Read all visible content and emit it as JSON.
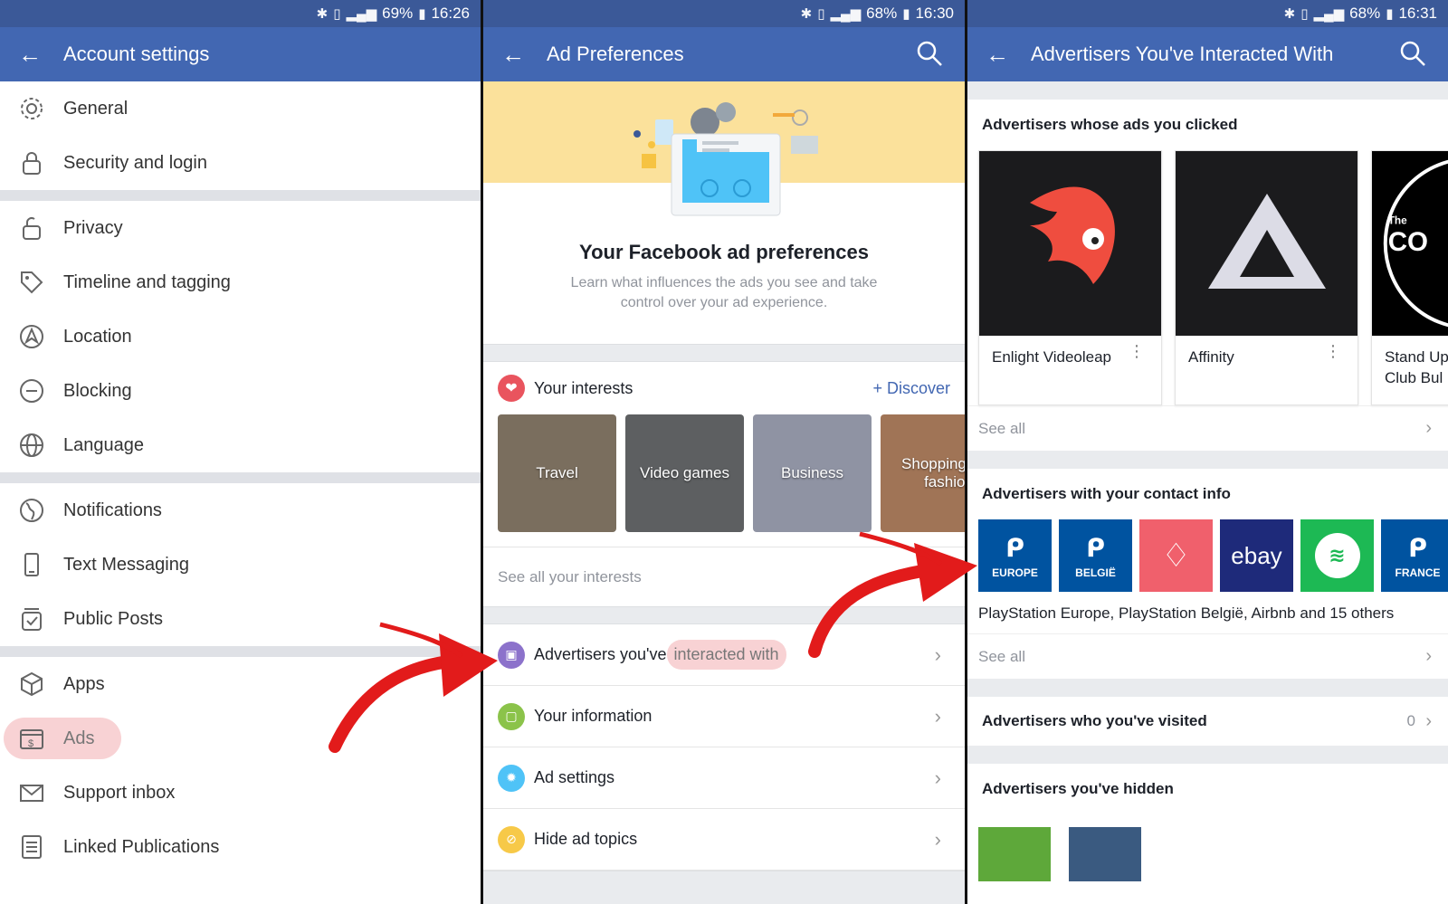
{
  "panel1": {
    "status": {
      "battery": "69%",
      "time": "16:26"
    },
    "appbar": {
      "title": "Account settings"
    },
    "items": [
      {
        "label": "General",
        "icon": "gear-icon"
      },
      {
        "label": "Security and login",
        "icon": "lock-icon"
      },
      {
        "label": "Privacy",
        "icon": "lock-privacy-icon"
      },
      {
        "label": "Timeline and tagging",
        "icon": "tag-icon"
      },
      {
        "label": "Location",
        "icon": "location-icon"
      },
      {
        "label": "Blocking",
        "icon": "blocking-icon"
      },
      {
        "label": "Language",
        "icon": "globe-icon"
      },
      {
        "label": "Notifications",
        "icon": "globe-notifications-icon"
      },
      {
        "label": "Text Messaging",
        "icon": "phone-icon"
      },
      {
        "label": "Public Posts",
        "icon": "public-posts-icon"
      },
      {
        "label": "Apps",
        "icon": "cube-icon"
      },
      {
        "label": "Ads",
        "icon": "ads-icon"
      },
      {
        "label": "Support inbox",
        "icon": "envelope-icon"
      },
      {
        "label": "Linked Publications",
        "icon": "document-icon"
      }
    ]
  },
  "panel2": {
    "status": {
      "battery": "68%",
      "time": "16:30"
    },
    "appbar": {
      "title": "Ad Preferences"
    },
    "hero": {
      "title": "Your Facebook ad preferences",
      "subtitle": "Learn what influences the ads you see and take control over your ad experience."
    },
    "interests": {
      "title": "Your interests",
      "discover": "Discover",
      "tiles": [
        {
          "label": "Travel",
          "color": "#7a6e5e"
        },
        {
          "label": "Video games",
          "color": "#5d5f61"
        },
        {
          "label": "Business",
          "color": "#8f93a3"
        },
        {
          "label": "Shopping and fashion",
          "color": "#a07456"
        }
      ],
      "see_all": "See all your interests"
    },
    "rows": [
      {
        "label_a": "Advertisers you've ",
        "label_b": "interacted with",
        "color": "#8c72cb"
      },
      {
        "label_a": "Your information",
        "label_b": "",
        "color": "#8bc34a"
      },
      {
        "label_a": "Ad settings",
        "label_b": "",
        "color": "#4fc3f7"
      },
      {
        "label_a": "Hide ad topics",
        "label_b": "",
        "color": "#f7c948"
      }
    ]
  },
  "panel3": {
    "status": {
      "battery": "68%",
      "time": "16:31"
    },
    "appbar": {
      "title": "Advertisers You've Interacted With"
    },
    "clicked": {
      "title": "Advertisers whose ads you clicked",
      "cards": [
        {
          "name": "Enlight Videoleap"
        },
        {
          "name": "Affinity"
        },
        {
          "name": "Stand Up Club Bul"
        }
      ],
      "see_all": "See all"
    },
    "contact": {
      "title": "Advertisers with your contact info",
      "logos": [
        {
          "text": "PS",
          "sub": "EUROPE",
          "color": "#0053a0"
        },
        {
          "text": "PS",
          "sub": "BELGIË",
          "color": "#0053a0"
        },
        {
          "text": "airbnb",
          "sub": "",
          "color": "#f0606c"
        },
        {
          "text": "ebay",
          "sub": "",
          "color": "#1e2a7a"
        },
        {
          "text": "spotify",
          "sub": "",
          "color": "#1db954"
        },
        {
          "text": "PS",
          "sub": "FRANCE",
          "color": "#0053a0"
        }
      ],
      "text": "PlayStation Europe, PlayStation België, Airbnb and 15 others",
      "see_all": "See all"
    },
    "visited": {
      "title": "Advertisers who you've visited",
      "count": "0"
    },
    "hidden": {
      "title": "Advertisers you've hidden"
    }
  }
}
